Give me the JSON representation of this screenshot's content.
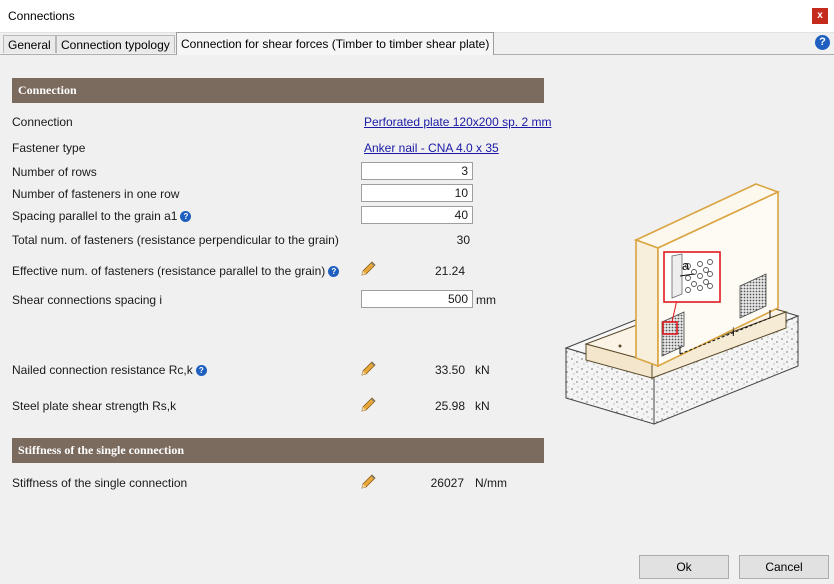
{
  "window": {
    "title": "Connections",
    "close_glyph": "x"
  },
  "tabs": [
    {
      "label": "General"
    },
    {
      "label": "Connection typology"
    },
    {
      "label": "Connection for shear forces (Timber to timber shear plate)"
    }
  ],
  "help_glyph": "?",
  "info_glyph": "?",
  "connection_section": {
    "header": "Connection",
    "connection_label": "Connection",
    "connection_value": "Perforated plate 120x200 sp. 2 mm",
    "fastener_type_label": "Fastener type",
    "fastener_type_value": "Anker nail - CNA 4.0 x 35",
    "rows_label": "Number of rows",
    "rows_value": "3",
    "fasteners_per_row_label": "Number of fasteners in one row",
    "fasteners_per_row_value": "10",
    "spacing_a1_label": "Spacing parallel to the grain a1",
    "spacing_a1_value": "40",
    "total_fasteners_label": "Total num. of fasteners (resistance perpendicular to the grain)",
    "total_fasteners_value": "30",
    "effective_fasteners_label": "Effective num. of fasteners (resistance parallel to the grain)",
    "effective_fasteners_value": "21.24",
    "shear_spacing_label": "Shear connections spacing i",
    "shear_spacing_value": "500",
    "shear_spacing_unit": "mm",
    "nailed_resistance_label": "Nailed connection resistance  Rc,k",
    "nailed_resistance_value": "33.50",
    "nailed_resistance_unit": "kN",
    "plate_strength_label": "Steel plate shear strength Rs,k",
    "plate_strength_value": "25.98",
    "plate_strength_unit": "kN"
  },
  "stiffness_section": {
    "header": "Stiffness of the single connection",
    "stiffness_label": "Stiffness of the single connection",
    "stiffness_value": "26027",
    "stiffness_unit": "N/mm"
  },
  "illustration": {
    "label_a": "a",
    "label_i": "i"
  },
  "buttons": {
    "ok": "Ok",
    "cancel": "Cancel"
  },
  "colors": {
    "section_header": "#7b6a5e",
    "link": "#1a1aa6",
    "timber_outline": "#d9a441",
    "highlight": "#e0191f"
  }
}
